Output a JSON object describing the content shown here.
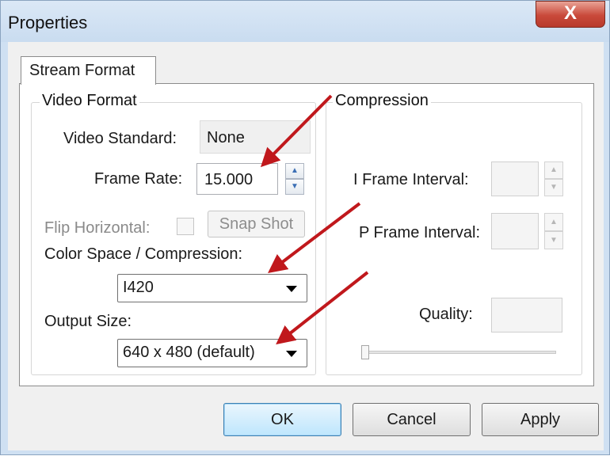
{
  "window": {
    "title": "Properties",
    "close_glyph": "X"
  },
  "tabs": [
    {
      "label": "Stream Format"
    }
  ],
  "video_format": {
    "title": "Video Format",
    "video_standard_label": "Video Standard:",
    "video_standard_value": "None",
    "frame_rate_label": "Frame Rate:",
    "frame_rate_value": "15.000",
    "flip_horizontal_label": "Flip Horizontal:",
    "snap_shot_label": "Snap Shot",
    "color_space_label": "Color Space / Compression:",
    "color_space_value": "I420",
    "output_size_label": "Output Size:",
    "output_size_value": "640 x 480  (default)"
  },
  "compression": {
    "title": "Compression",
    "i_frame_label": "I Frame Interval:",
    "i_frame_value": "",
    "p_frame_label": "P Frame Interval:",
    "p_frame_value": "",
    "quality_label": "Quality:",
    "quality_value": "",
    "quality_slider_level": 0
  },
  "buttons": {
    "ok": "OK",
    "cancel": "Cancel",
    "apply": "Apply"
  },
  "icons": {
    "spin_up": "▲",
    "spin_down": "▼"
  },
  "colors": {
    "annotation_arrow": "#c0181c",
    "close_button": "#c9493a"
  }
}
